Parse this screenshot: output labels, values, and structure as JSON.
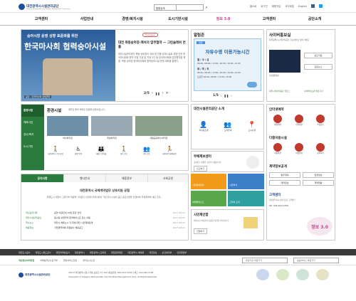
{
  "logo": {
    "name": "대전광역시시설관리공단",
    "sub": "Daejeon Metropolitan City Facilities Management Corporation"
  },
  "search": {
    "select": "통합검색",
    "placeholder": ""
  },
  "util": [
    "홈으로",
    "로그인",
    "회원가입",
    "사이트맵",
    "English"
  ],
  "gnb": [
    "고객센터",
    "사업안내",
    "경영/복지시설",
    "도시기반시설",
    "정보공개",
    "고객센터",
    "공단소개"
  ],
  "slogan": "정보 3.0",
  "banner": {
    "tag": "Hot Issue",
    "top": "숭아시장 운영 상향 표준화를 위한",
    "main": "한국마사회 협력숭아시설",
    "caption": "공단 - 한국마사회 상호협약",
    "title": "대전 목동숭마장-해석의 업무협약 — 그린슬래쉬 연출",
    "body": "대전시설관리공단 목동 승마장이 국내 첫 인증 승마시설로 경영·건전 한국마사회와 협약 선정 기념 및 지정 3건 동 한국마사회와 업무협약을 체결. 목동 승마장 한국마사회와 협력승마시설 운영 계획을 알렸다.",
    "pager": "2/5"
  },
  "notice": {
    "title": "알림존",
    "tag": "알림",
    "box_title": "자유수영 이용가능시간",
    "tabs": [
      "월 / 수 / 금",
      "화 / 목 / 토"
    ],
    "times": [
      "06:00~08:00 / 13:00~16:00 / 19:00~21:00",
      "06:00~08:00 / 13:00~15:00 / 19:00~21:00",
      "토요일 06:00~08:00 / 13:00~15:00"
    ],
    "pager": "1/5"
  },
  "cyber": {
    "title": "사이버홍보실",
    "desc": "대전광역시시설관리공단 홍보센터로 찾아가세요",
    "more": "홍보동영상",
    "btn1": "보도자료",
    "btn2": "포토뉴스",
    "link1": "대전시설관리공단 블로그",
    "link2": "사이버홍보관 바로가기"
  },
  "env": {
    "side": [
      "환경사업",
      "체육사업",
      "경사/복지",
      "도시기반"
    ],
    "title": "환경시설",
    "desc": "깨끗한 물과 쾌적한 환경을 만들어갑니다.",
    "photos": [
      "하수처리장",
      "위생처리장",
      "대동공공하수처리장"
    ],
    "icons": [
      "대전광역시 수도사업",
      "현장 목적",
      "대청소 음식물",
      "현수 선도",
      "공동 선도",
      "대전자연 환경사업"
    ]
  },
  "intro": {
    "title": "대전시설관리공단 소개",
    "items": [
      "이사장소개",
      "조직안내",
      "오시는길"
    ]
  },
  "pf": {
    "title": "부패제보센터",
    "desc": "공정하고 청렴한 공단이 되겠습니다.",
    "btn": "신고하기"
  },
  "family": {
    "items": [
      "시민참여센터",
      "시민역사",
      "부패행위신고",
      "고객의 소리"
    ]
  },
  "plan": {
    "title": "시민제안함",
    "desc": "대전시민 여러분의 소중한 의견을 기다립니다.",
    "btn": "신청하기"
  },
  "right": {
    "title": "인터넷예약",
    "icons": [
      "대전전대",
      "전력지원",
      "수영강습"
    ],
    "t2": "다중이용시설",
    "icons2": [
      "이용이관",
      "이용안내",
      "공지하기"
    ],
    "t3": "계약정보공개",
    "btns": [
      "발주계획",
      "입찰정보",
      "계약정보",
      "계약현황"
    ],
    "cc_title": "고객센터",
    "cc_desc": "대전광역시시설관리공단 고객센터",
    "phone": "Tel: 042-610-2700"
  },
  "board": {
    "tabs": [
      "공지사항",
      "행사안내",
      "채용정보",
      "사회공헌"
    ],
    "title": "대전광역시 국제계약업무 상호지원 공협",
    "summary": "파행도시 대전이 고위기술 역량을 가져온다 인천대 국제사회의 가장 우수시설의 공단 공모사업을 진행하며 국제계약에 새로 추진...",
    "list": [
      [
        "최신공지사항",
        "공연 이용안내 10월 휴관 안내",
        "2017-08-03"
      ],
      [
        "대전시설관리공단",
        "웅수동 상업지역 원격하이스트 장소 이용",
        "2017-08-03"
      ],
      [
        "최신뉴스",
        "대전시 체육소시 각 회생 대전 시민행복운영",
        "2017-08-03"
      ],
      [
        "채용정보",
        "가임행렬하체 자원봉사 채용공고",
        "2017-08-01"
      ]
    ]
  },
  "footer": {
    "links": [
      "대전도시공사",
      "대전도시철도공사",
      "대전마케팅공사",
      "대전광역시",
      "대전광역시 교육청",
      "대전문화재단",
      "대전광역시 체육회",
      "대전정보",
      "보건복지부",
      "안전행정부"
    ],
    "links2": [
      "개인정보처리방침",
      "이메일무단수집거부",
      "행정서비스헌장",
      "찾아오시는길"
    ],
    "sel1": "유관기관 바로가기",
    "sel2": "공공서비스 바로가기",
    "addr": "34113 대전광역시 동구 안동 보문로 5가 109 [대표번호: 042-610-2700] | 팩스: 042-610-2748",
    "copy": "Copyright (c) Daejeon Metropolitan City Facilities Management Corp. All Rights Reserved.",
    "cert": [
      "인증마크1",
      "인증마크2",
      "인증마크3",
      "인증마크4"
    ]
  }
}
